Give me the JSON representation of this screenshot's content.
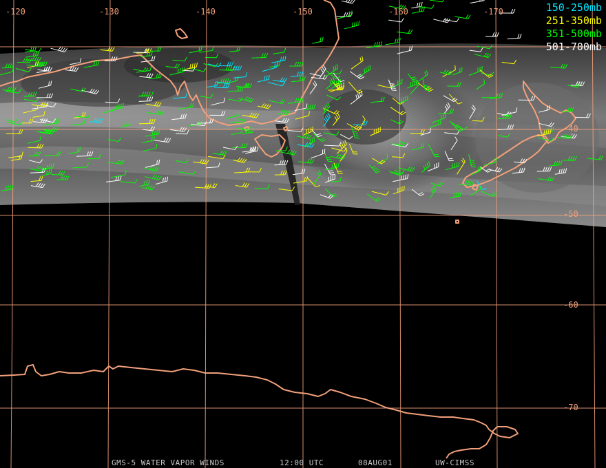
{
  "colors": {
    "grid": "#f2a07a",
    "coast": "#f2a07a",
    "background": "#000000"
  },
  "grid": {
    "lon_labels": [
      "-120",
      "-130",
      "-140",
      "-150",
      "-160",
      "-170"
    ],
    "lat_labels": [
      "-40",
      "-50",
      "-60",
      "-70"
    ]
  },
  "legend": [
    {
      "label": "150-250mb",
      "color": "#00e8ff"
    },
    {
      "label": "251-350mb",
      "color": "#ffff00"
    },
    {
      "label": "351-500mb",
      "color": "#00ff00"
    },
    {
      "label": "501-700mb",
      "color": "#ffffff"
    }
  ],
  "footer": {
    "product": "GMS-5 WATER VAPOR WINDS",
    "time": "12:00 UTC",
    "date": "08AUG01",
    "source": "UW-CIMSS"
  }
}
